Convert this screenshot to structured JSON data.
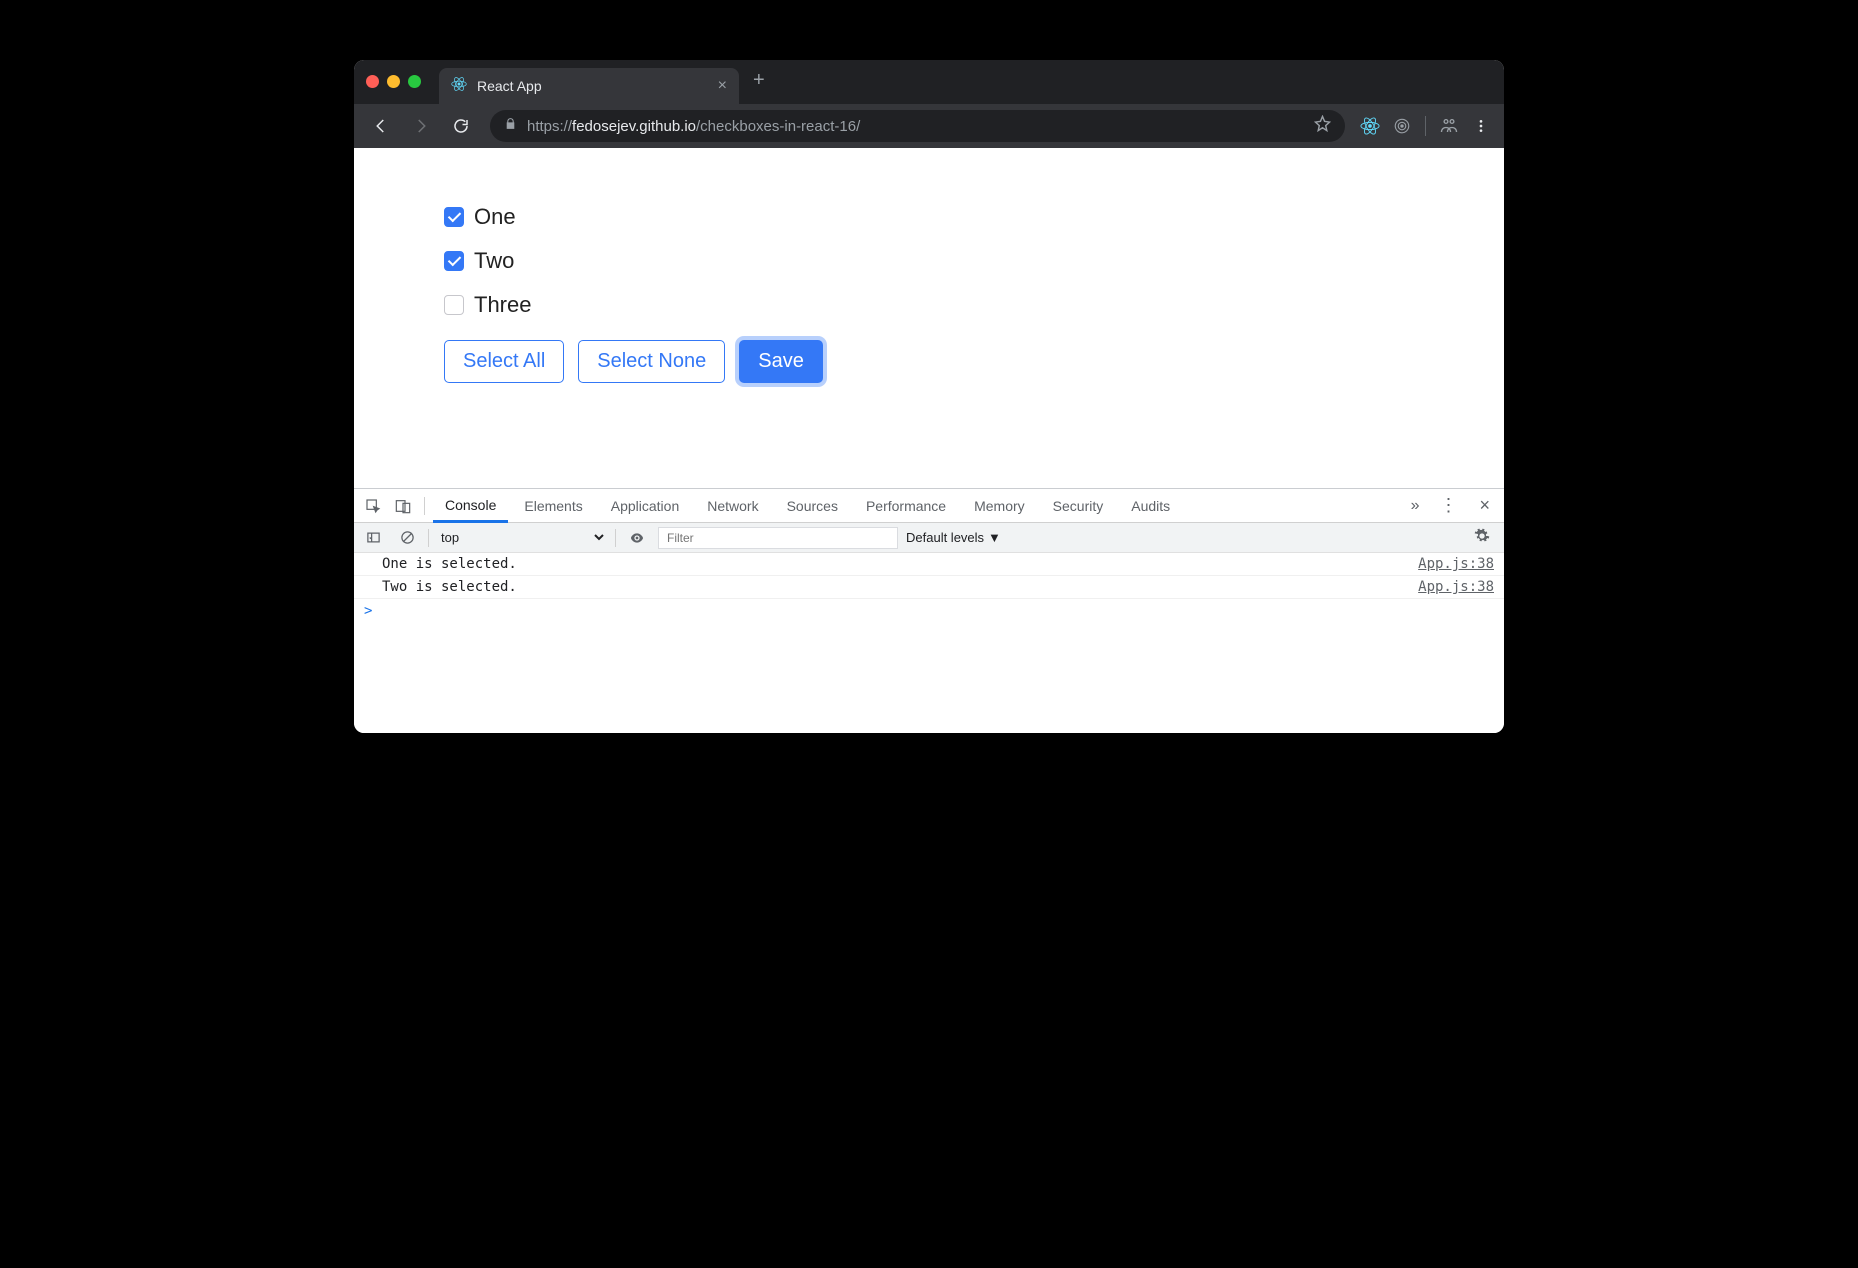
{
  "window": {
    "tab_title": "React App",
    "url_scheme": "https://",
    "url_host": "fedosejev.github.io",
    "url_path": "/checkboxes-in-react-16/"
  },
  "page": {
    "checkboxes": [
      {
        "label": "One",
        "checked": true
      },
      {
        "label": "Two",
        "checked": true
      },
      {
        "label": "Three",
        "checked": false
      }
    ],
    "select_all_label": "Select All",
    "select_none_label": "Select None",
    "save_label": "Save"
  },
  "devtools": {
    "tab_console": "Console",
    "tab_elements": "Elements",
    "tab_application": "Application",
    "tab_network": "Network",
    "tab_sources": "Sources",
    "tab_performance": "Performance",
    "tab_memory": "Memory",
    "tab_security": "Security",
    "tab_audits": "Audits",
    "consolebar": {
      "context": "top",
      "filter_placeholder": "Filter",
      "levels": "Default levels"
    },
    "log_entries": [
      {
        "message": "One is selected.",
        "source": "App.js:38"
      },
      {
        "message": "Two is selected.",
        "source": "App.js:38"
      }
    ],
    "prompt": ">"
  }
}
